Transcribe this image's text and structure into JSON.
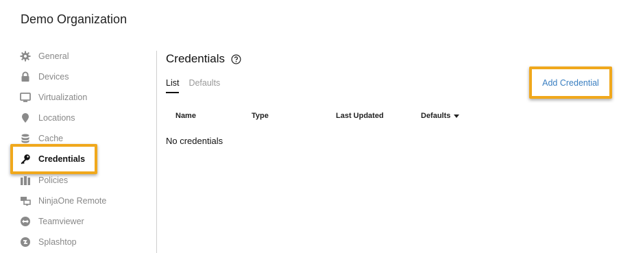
{
  "organization": {
    "name": "Demo Organization"
  },
  "sidebar": {
    "items": [
      {
        "label": "General",
        "icon": "gear-icon"
      },
      {
        "label": "Devices",
        "icon": "lock-icon"
      },
      {
        "label": "Virtualization",
        "icon": "monitor-icon"
      },
      {
        "label": "Locations",
        "icon": "map-pin-icon"
      },
      {
        "label": "Cache",
        "icon": "database-icon"
      },
      {
        "label": "Credentials",
        "icon": "key-icon",
        "active": true
      },
      {
        "label": "Policies",
        "icon": "policies-icon"
      },
      {
        "label": "NinjaOne Remote",
        "icon": "remote-screens-icon"
      },
      {
        "label": "Teamviewer",
        "icon": "teamviewer-icon"
      },
      {
        "label": "Splashtop",
        "icon": "splashtop-icon"
      }
    ]
  },
  "main": {
    "title": "Credentials",
    "help_icon": "question-circle-icon",
    "tabs": [
      {
        "label": "List",
        "active": true
      },
      {
        "label": "Defaults",
        "active": false
      }
    ],
    "add_button": "Add Credential",
    "table": {
      "headers": [
        "Name",
        "Type",
        "Last Updated",
        "Defaults"
      ],
      "empty_text": "No credentials"
    }
  },
  "colors": {
    "highlight": "#f0a81c",
    "link": "#3a7fc1",
    "muted": "#888888"
  }
}
